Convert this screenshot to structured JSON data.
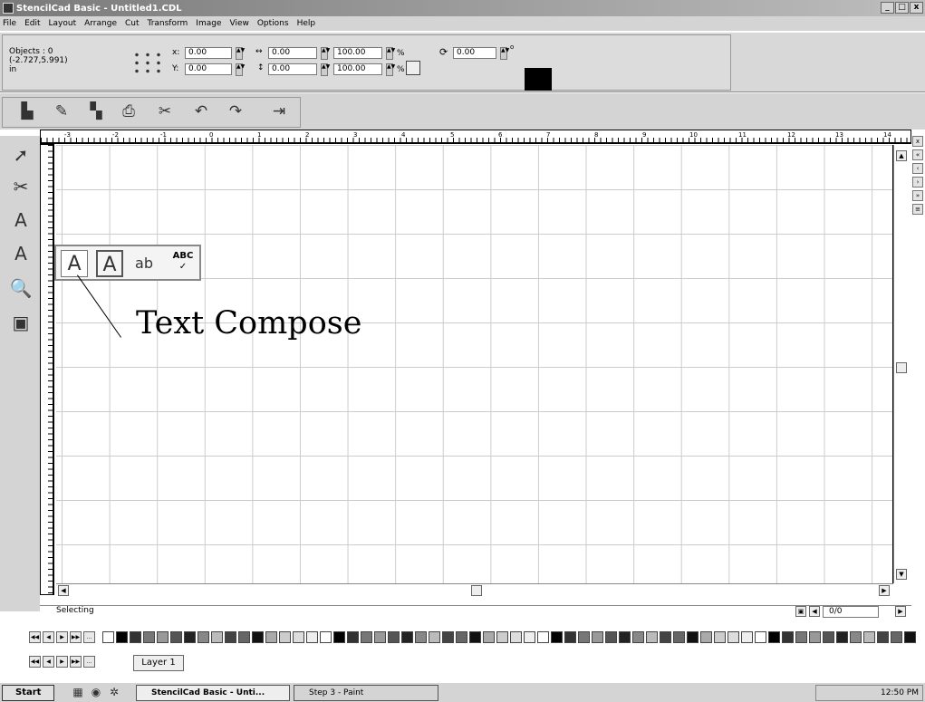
{
  "window": {
    "title": "StencilCad Basic - Untitled1.CDL",
    "controls": [
      "_",
      "□",
      "x"
    ]
  },
  "menu": [
    "File",
    "Edit",
    "Layout",
    "Arrange",
    "Cut",
    "Transform",
    "Image",
    "View",
    "Options",
    "Help"
  ],
  "properties": {
    "objects": "Objects : 0",
    "coords": "(-2.727,5.991)",
    "units": "in",
    "x_label": "x:",
    "x_value": "0.00",
    "y_label": "Y:",
    "y_value": "0.00",
    "width_value": "0.00",
    "height_value": "0.00",
    "scale_x": "100.00",
    "scale_y": "100.00",
    "percent": "%",
    "rotation": "0.00",
    "degree": "o"
  },
  "ruler_top_labels": [
    "-3",
    "-2",
    "-1",
    "0",
    "1",
    "2",
    "3",
    "4",
    "5",
    "6",
    "7",
    "8",
    "9",
    "10",
    "11",
    "12",
    "13",
    "14"
  ],
  "flyout": {
    "abc_label": "ABC",
    "check": "✓"
  },
  "callout": "Text Compose",
  "status": {
    "mode": "Selecting",
    "page": "0/0"
  },
  "layer": "Layer 1",
  "taskbar": {
    "start": "Start",
    "task1": "StencilCad Basic - Unti...",
    "task2": "Step 3 - Paint",
    "time": "12:50 PM"
  },
  "palette_colors": [
    "#ffffff",
    "#000000",
    "#333333",
    "#777777",
    "#999999",
    "#555555",
    "#222222",
    "#888888",
    "#bbbbbb",
    "#444444",
    "#666666",
    "#111111",
    "#aaaaaa",
    "#cccccc",
    "#dddddd",
    "#eeeeee"
  ]
}
